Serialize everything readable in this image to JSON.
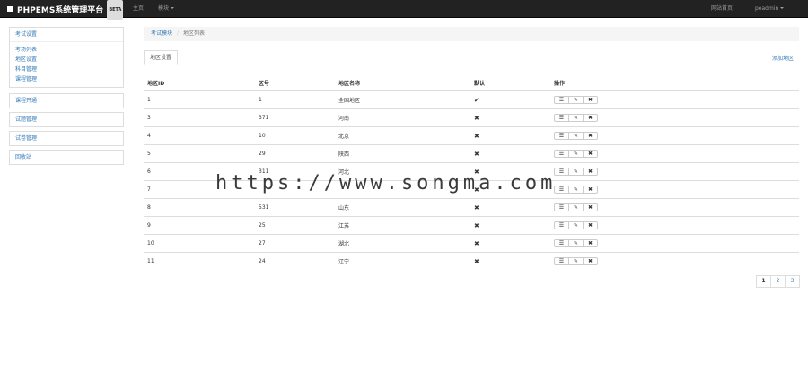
{
  "app": {
    "title": "PHPEMS系统管理平台",
    "badge": "BETA"
  },
  "topnav": {
    "home": "主页",
    "modules": "模块",
    "site_home": "网站首页",
    "user": "peadmin"
  },
  "sidebar": {
    "groups": [
      {
        "title": "考试设置",
        "items": [
          "考场列表",
          "地区设置",
          "科目管理",
          "课程管理"
        ]
      },
      {
        "title": "课程开通",
        "items": []
      },
      {
        "title": "试题管理",
        "items": []
      },
      {
        "title": "试卷管理",
        "items": []
      },
      {
        "title": "回收站",
        "items": []
      }
    ]
  },
  "breadcrumb": {
    "parent": "考试模块",
    "current": "地区列表"
  },
  "tab": {
    "label": "地区设置"
  },
  "actions": {
    "add": "添加地区"
  },
  "table": {
    "headers": [
      "地区ID",
      "区号",
      "地区名称",
      "默认",
      "操作"
    ],
    "rows": [
      {
        "id": "1",
        "code": "1",
        "name": "全国地区",
        "default": true
      },
      {
        "id": "3",
        "code": "371",
        "name": "河南",
        "default": false
      },
      {
        "id": "4",
        "code": "10",
        "name": "北京",
        "default": false
      },
      {
        "id": "5",
        "code": "29",
        "name": "陕西",
        "default": false
      },
      {
        "id": "6",
        "code": "311",
        "name": "河北",
        "default": false
      },
      {
        "id": "7",
        "code": "",
        "name": "",
        "default": false
      },
      {
        "id": "8",
        "code": "531",
        "name": "山东",
        "default": false
      },
      {
        "id": "9",
        "code": "25",
        "name": "江苏",
        "default": false
      },
      {
        "id": "10",
        "code": "27",
        "name": "湖北",
        "default": false
      },
      {
        "id": "11",
        "code": "24",
        "name": "辽宁",
        "default": false
      }
    ]
  },
  "icons": {
    "list": "list-icon",
    "edit": "edit-icon",
    "delete": "delete-icon",
    "default_yes": "check-icon",
    "default_no": "cross-icon"
  },
  "pagination": {
    "pages": [
      "1",
      "2",
      "3"
    ],
    "current": "1"
  },
  "watermark": "https://www.songma.com"
}
